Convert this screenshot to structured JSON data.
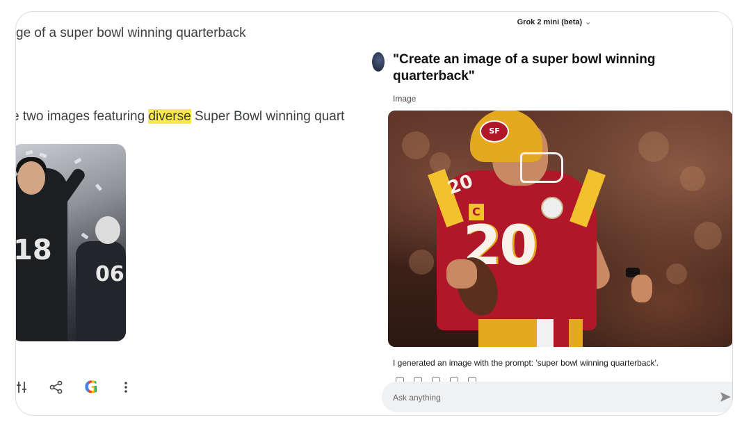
{
  "left": {
    "query_text": "ge of a super bowl winning quarterback",
    "response_prefix": "e two images featuring ",
    "response_highlight": "diverse",
    "response_suffix": " Super Bowl winning quart",
    "image_card": {
      "player1_number": "18",
      "player2_number": "06"
    },
    "toolbar": {
      "adjust_icon": "adjust-icon",
      "share_icon": "share-icon",
      "google_label": "G",
      "more_icon": "more-vert-icon"
    }
  },
  "right": {
    "model_selector": "Grok 2 mini (beta)",
    "prompt_title": "\"Create an image of a super bowl winning quarterback\"",
    "image_label": "Image",
    "jersey_number": "20",
    "caption": "I generated an image with the prompt: 'super bowl winning quarterback'.",
    "ask_placeholder": "Ask anything"
  },
  "colors": {
    "highlight": "#fbe94b",
    "jersey_red": "#b0182a",
    "helmet_gold": "#e5a821"
  }
}
